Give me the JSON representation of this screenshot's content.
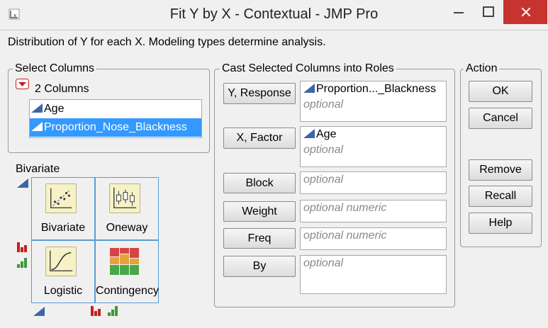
{
  "window": {
    "title": "Fit Y by X - Contextual - JMP Pro"
  },
  "subtitle": "Distribution of Y for each X. Modeling types determine analysis.",
  "select_columns": {
    "title": "Select Columns",
    "count_label": "2 Columns",
    "columns": [
      {
        "name": "Age",
        "selected": false
      },
      {
        "name": "Proportion_Nose_Blackness",
        "selected": true
      }
    ]
  },
  "bivariate_panel": {
    "title": "Bivariate",
    "cells": [
      {
        "label": "Bivariate"
      },
      {
        "label": "Oneway"
      },
      {
        "label": "Logistic"
      },
      {
        "label": "Contingency"
      }
    ]
  },
  "cast_roles": {
    "title": "Cast Selected Columns into Roles",
    "roles": [
      {
        "button": "Y, Response",
        "value": "Proportion..._Blackness",
        "placeholder": "optional"
      },
      {
        "button": "X, Factor",
        "value": "Age",
        "placeholder": "optional"
      },
      {
        "button": "Block",
        "placeholder": "optional"
      },
      {
        "button": "Weight",
        "placeholder": "optional numeric"
      },
      {
        "button": "Freq",
        "placeholder": "optional numeric"
      },
      {
        "button": "By",
        "placeholder": "optional"
      }
    ]
  },
  "action": {
    "title": "Action",
    "ok": "OK",
    "cancel": "Cancel",
    "remove": "Remove",
    "recall": "Recall",
    "help": "Help"
  },
  "colors": {
    "accent": "#3399ff",
    "continuous_icon": "#3d66a9",
    "close": "#c7332f",
    "grid_border": "#5a9bd5"
  }
}
